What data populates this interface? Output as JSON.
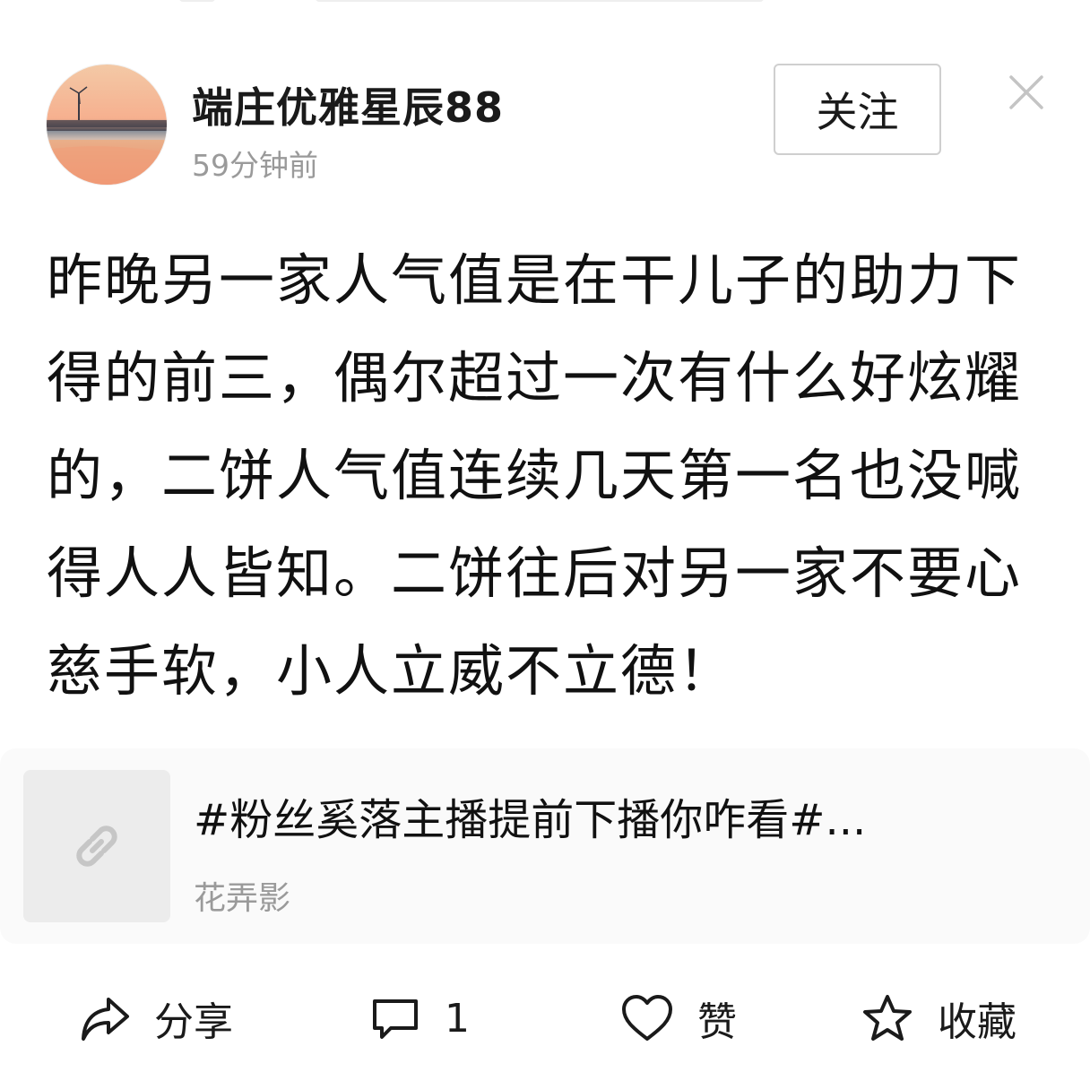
{
  "post": {
    "author": "端庄优雅星辰88",
    "time": "59分钟前",
    "follow_label": "关注",
    "text": "昨晚另一家人气值是在干儿子的助力下得的前三，偶尔超过一次有什么好炫耀的，二饼人气值连续几天第一名也没喊得人人皆知。二饼往后对另一家不要心慈手软，小人立威不立德！"
  },
  "link_card": {
    "title": "#粉丝奚落主播提前下播你咋看#...",
    "source": "花弄影",
    "icon": "link-icon"
  },
  "actions": {
    "share_label": "分享",
    "comment_count": "1",
    "like_label": "赞",
    "collect_label": "收藏"
  },
  "icons": {
    "close": "close-icon",
    "share": "share-icon",
    "comment": "comment-icon",
    "like": "heart-icon",
    "collect": "star-icon"
  }
}
